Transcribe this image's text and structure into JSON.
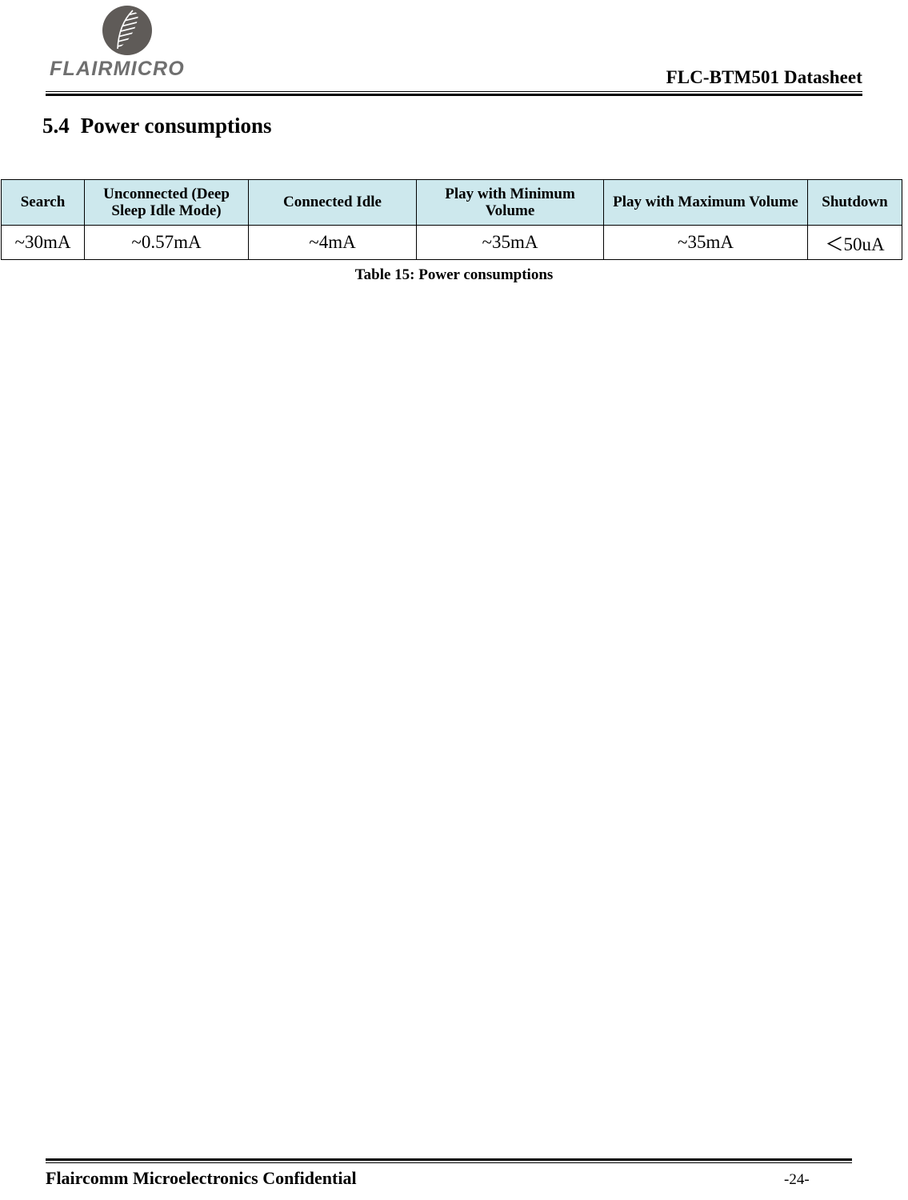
{
  "header": {
    "logo_icon": "flairmicro-circle-logo",
    "brand": "FLAIRMICRO",
    "document_title": "FLC-BTM501 Datasheet"
  },
  "section": {
    "number": "5.4",
    "title": "Power consumptions"
  },
  "table": {
    "caption": "Table 15: Power consumptions",
    "header_background": "#cde8ed",
    "columns": [
      "Search",
      "Unconnected (Deep Sleep Idle Mode)",
      "Connected Idle",
      "Play with Minimum Volume",
      "Play with Maximum Volume",
      "Shutdown"
    ],
    "rows": [
      [
        "~30mA",
        "~0.57mA",
        "~4mA",
        "~35mA",
        "~35mA",
        "＜50uA"
      ]
    ]
  },
  "footer": {
    "confidential": "Flaircomm Microelectronics Confidential",
    "page_number": "-24-"
  }
}
